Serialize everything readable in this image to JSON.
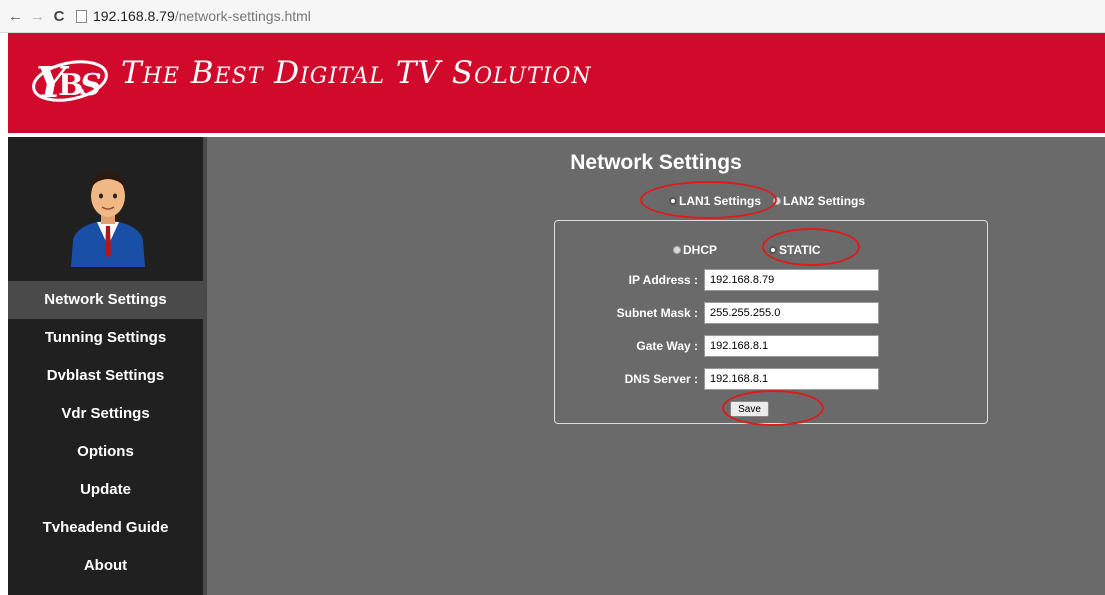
{
  "browser": {
    "url_host": "192.168.8.79",
    "url_path": "/network-settings.html"
  },
  "header": {
    "brand": "The Best Digital TV Solution"
  },
  "sidebar": {
    "items": [
      {
        "label": "Network Settings"
      },
      {
        "label": "Tunning Settings"
      },
      {
        "label": "Dvblast Settings"
      },
      {
        "label": "Vdr Settings"
      },
      {
        "label": "Options"
      },
      {
        "label": "Update"
      },
      {
        "label": "Tvheadend Guide"
      },
      {
        "label": "About"
      }
    ]
  },
  "main": {
    "title": "Network Settings",
    "lan1": "LAN1 Settings",
    "lan2": "LAN2 Settings",
    "dhcp": "DHCP",
    "static": "STATIC",
    "fields": [
      {
        "label": "IP Address :",
        "value": "192.168.8.79"
      },
      {
        "label": "Subnet Mask :",
        "value": "255.255.255.0"
      },
      {
        "label": "Gate Way :",
        "value": "192.168.8.1"
      },
      {
        "label": "DNS Server :",
        "value": "192.168.8.1"
      }
    ],
    "save": "Save"
  },
  "colors": {
    "header": "#d10a2b",
    "sidebar": "#202020",
    "main": "#6a6a6a",
    "annotation": "#e01a1a"
  }
}
